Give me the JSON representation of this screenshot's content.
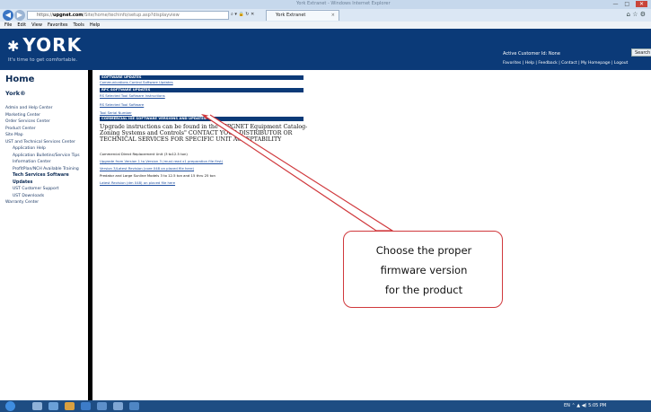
{
  "window": {
    "title": "York Extranet - Windows Internet Explorer"
  },
  "browser": {
    "url_https": "https://",
    "url_host": "upgnet.com",
    "url_path": "/Site/home/techinfo/setup.asp?displayview",
    "tab_label": "York Extranet",
    "tab_close": "×"
  },
  "menu": [
    "File",
    "Edit",
    "View",
    "Favorites",
    "Tools",
    "Help"
  ],
  "header": {
    "logo": "YORK",
    "tagline": "It's time to get comfortable.",
    "customer": "Active Customer Id: None",
    "search": "Search",
    "toplinks": "Favorites | Help | Feedback | Contact | My Homepage | Logout"
  },
  "sidebar": {
    "home": "Home",
    "brand": "York®",
    "items": [
      "Admin and Help Center",
      "Marketing Center",
      "Order Services Center",
      "Product Center",
      "Site Map",
      "UST and Technical Services Center"
    ],
    "subitems": [
      "Application Help",
      "Application Bulletins/Service Tips",
      "Information Center",
      "ProfitPlan/NCH Available Training"
    ],
    "highlight": "Tech Services Software Updates",
    "subitems2": [
      "UST Customer Support",
      "UST Downloads"
    ],
    "last": "Warranty Center"
  },
  "content": {
    "bar1": "SOFTWARE UPDATES",
    "link1": "Communications Control Software Updates",
    "bar2": "RPC SOFTWARE UPDATES",
    "link2": "RS Selected Tool Software Instructions",
    "link3": "RS Selected Tool Software",
    "link4": "Tool Serial Number",
    "bar3": "COMMERCIAL IGE SOFTWARE VERSIONS AND UPDATES",
    "paragraph": "Upgrade instructions can be found in the \"UPGNET Equipment Catalog-Zoning Systems and Controls\" CONTACT YOUR DISTRIBUTOR OR TECHNICAL SERVICES FOR SPECIFIC UNIT ACCEPTABILITY",
    "line1": "Commercial Direct Replacement Unit (3 to12.5 ton)",
    "link5": "Upgrade from Version 1 to Version 3 (must read x1 preparation file first)",
    "link6": "Version 3/Latest Revision (core 048 on placed file here)",
    "line2": "Predator and Large Sunline Models 3 to 12.5 ton and 15 thru 25 ton",
    "link7": "Latest Revision (dm 048) on placed file here"
  },
  "annotation": {
    "lines": [
      "Choose the proper",
      "firmware version",
      "for the product"
    ]
  },
  "taskbar": {
    "tray": "EN  ⌃  ▲  ◀)  5:05 PM"
  }
}
